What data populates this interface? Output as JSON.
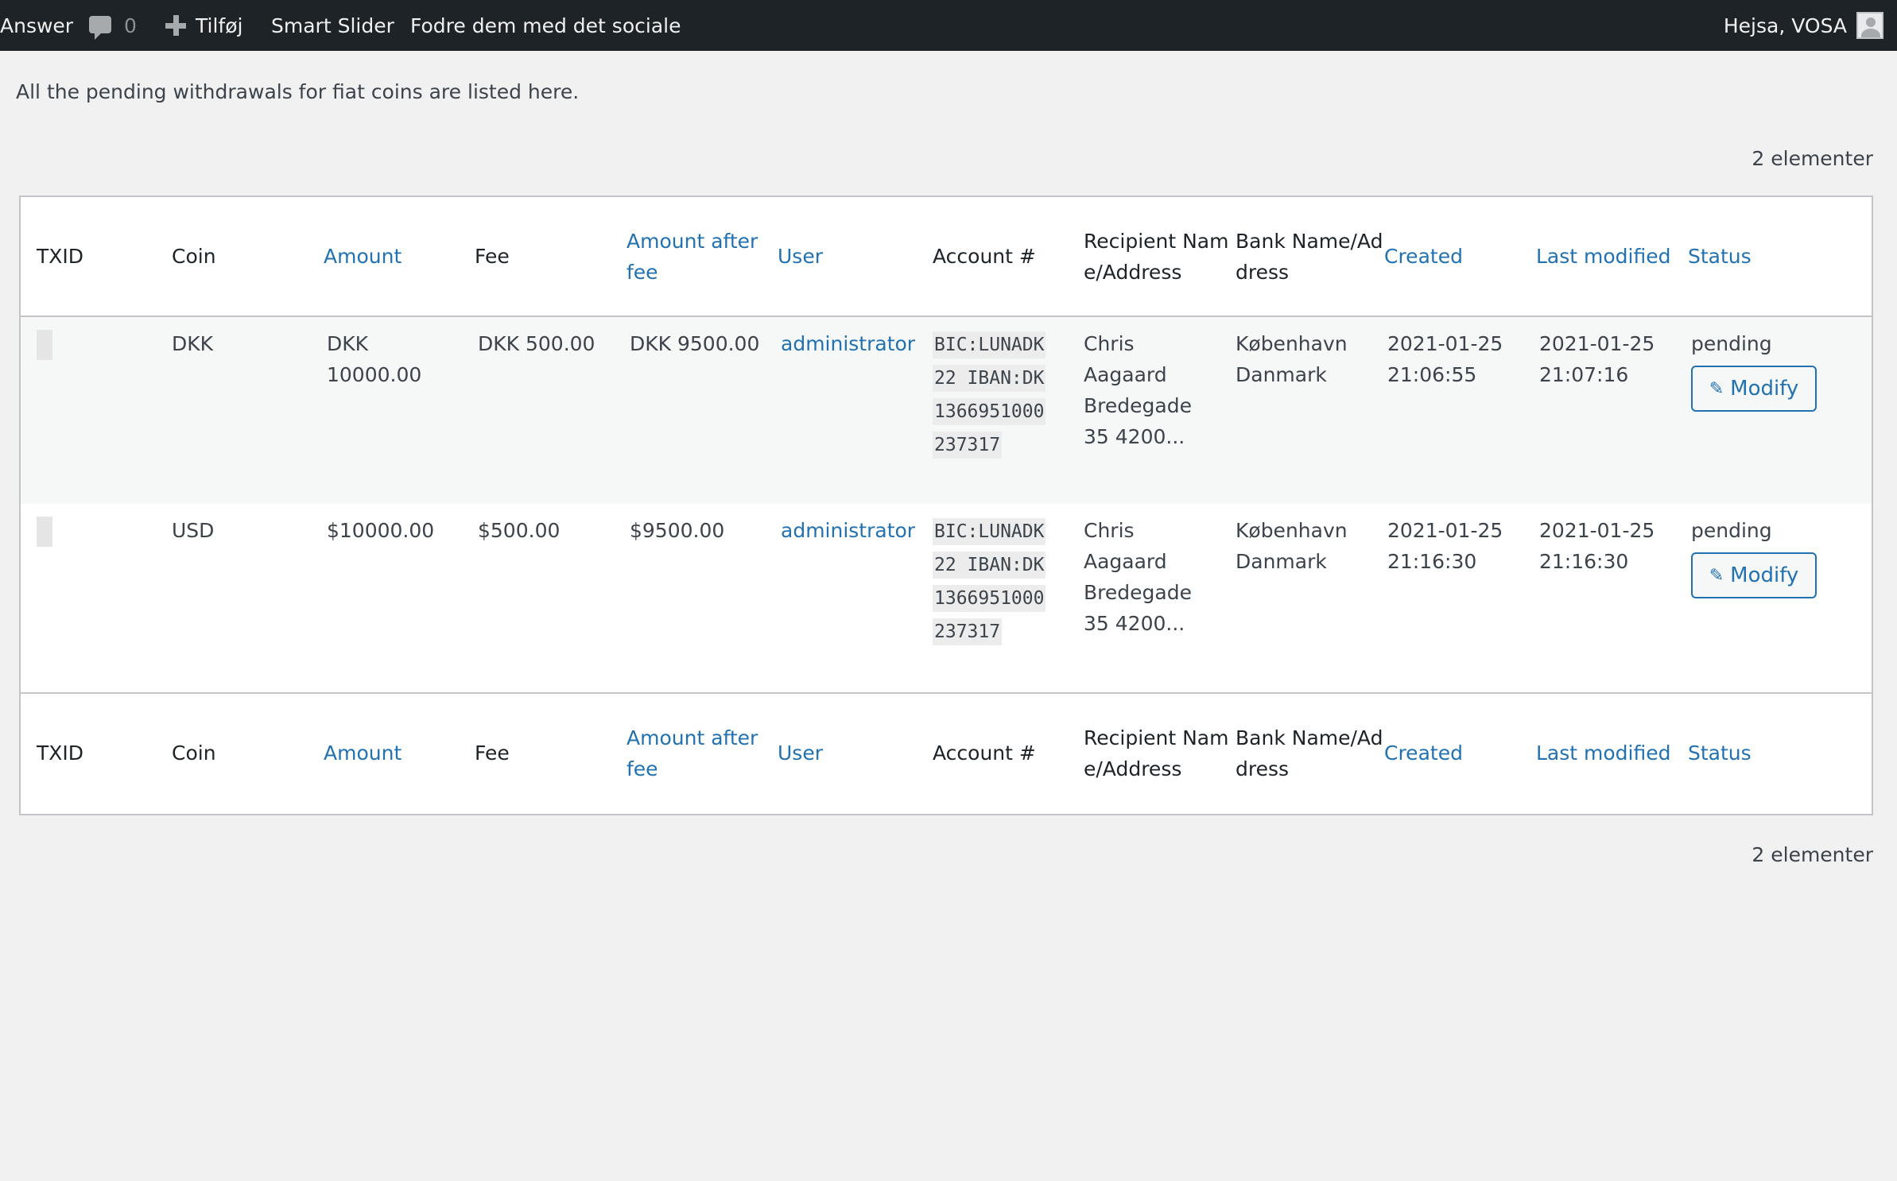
{
  "admin_bar": {
    "site_label": "Answer",
    "comments_count": "0",
    "new_label": "Tilføj",
    "smart_slider": "Smart Slider",
    "fodre": "Fodre dem med det sociale",
    "greeting": "Hejsa, VOSA"
  },
  "page": {
    "description": "All the pending withdrawals for fiat coins are listed here.",
    "item_count": "2 elementer"
  },
  "columns": {
    "txid": "TXID",
    "coin": "Coin",
    "amount": "Amount",
    "fee": "Fee",
    "amount_after_fee": "Amount after fee",
    "user": "User",
    "account": "Account #",
    "recipient": "Recipient Name/Address",
    "bank": "Bank Name/Address",
    "created": "Created",
    "last_modified": "Last modified",
    "status": "Status"
  },
  "rows": [
    {
      "coin": "DKK",
      "amount": "DKK 10000.00",
      "fee": "DKK 500.00",
      "amount_after_fee": "DKK 9500.00",
      "user": "administrator",
      "account": "BIC:LUNADK22 IBAN:DK1366951000237317",
      "recipient": "Chris Aagaard Bredegade 35 4200...",
      "bank": "København Danmark",
      "created": "2021-01-25 21:06:55",
      "last_modified": "2021-01-25 21:07:16",
      "status": "pending",
      "action": "Modify"
    },
    {
      "coin": "USD",
      "amount": "$10000.00",
      "fee": "$500.00",
      "amount_after_fee": "$9500.00",
      "user": "administrator",
      "account": "BIC:LUNADK22 IBAN:DK1366951000237317",
      "recipient": "Chris Aagaard Bredegade 35 4200...",
      "bank": "København Danmark",
      "created": "2021-01-25 21:16:30",
      "last_modified": "2021-01-25 21:16:30",
      "status": "pending",
      "action": "Modify"
    }
  ]
}
